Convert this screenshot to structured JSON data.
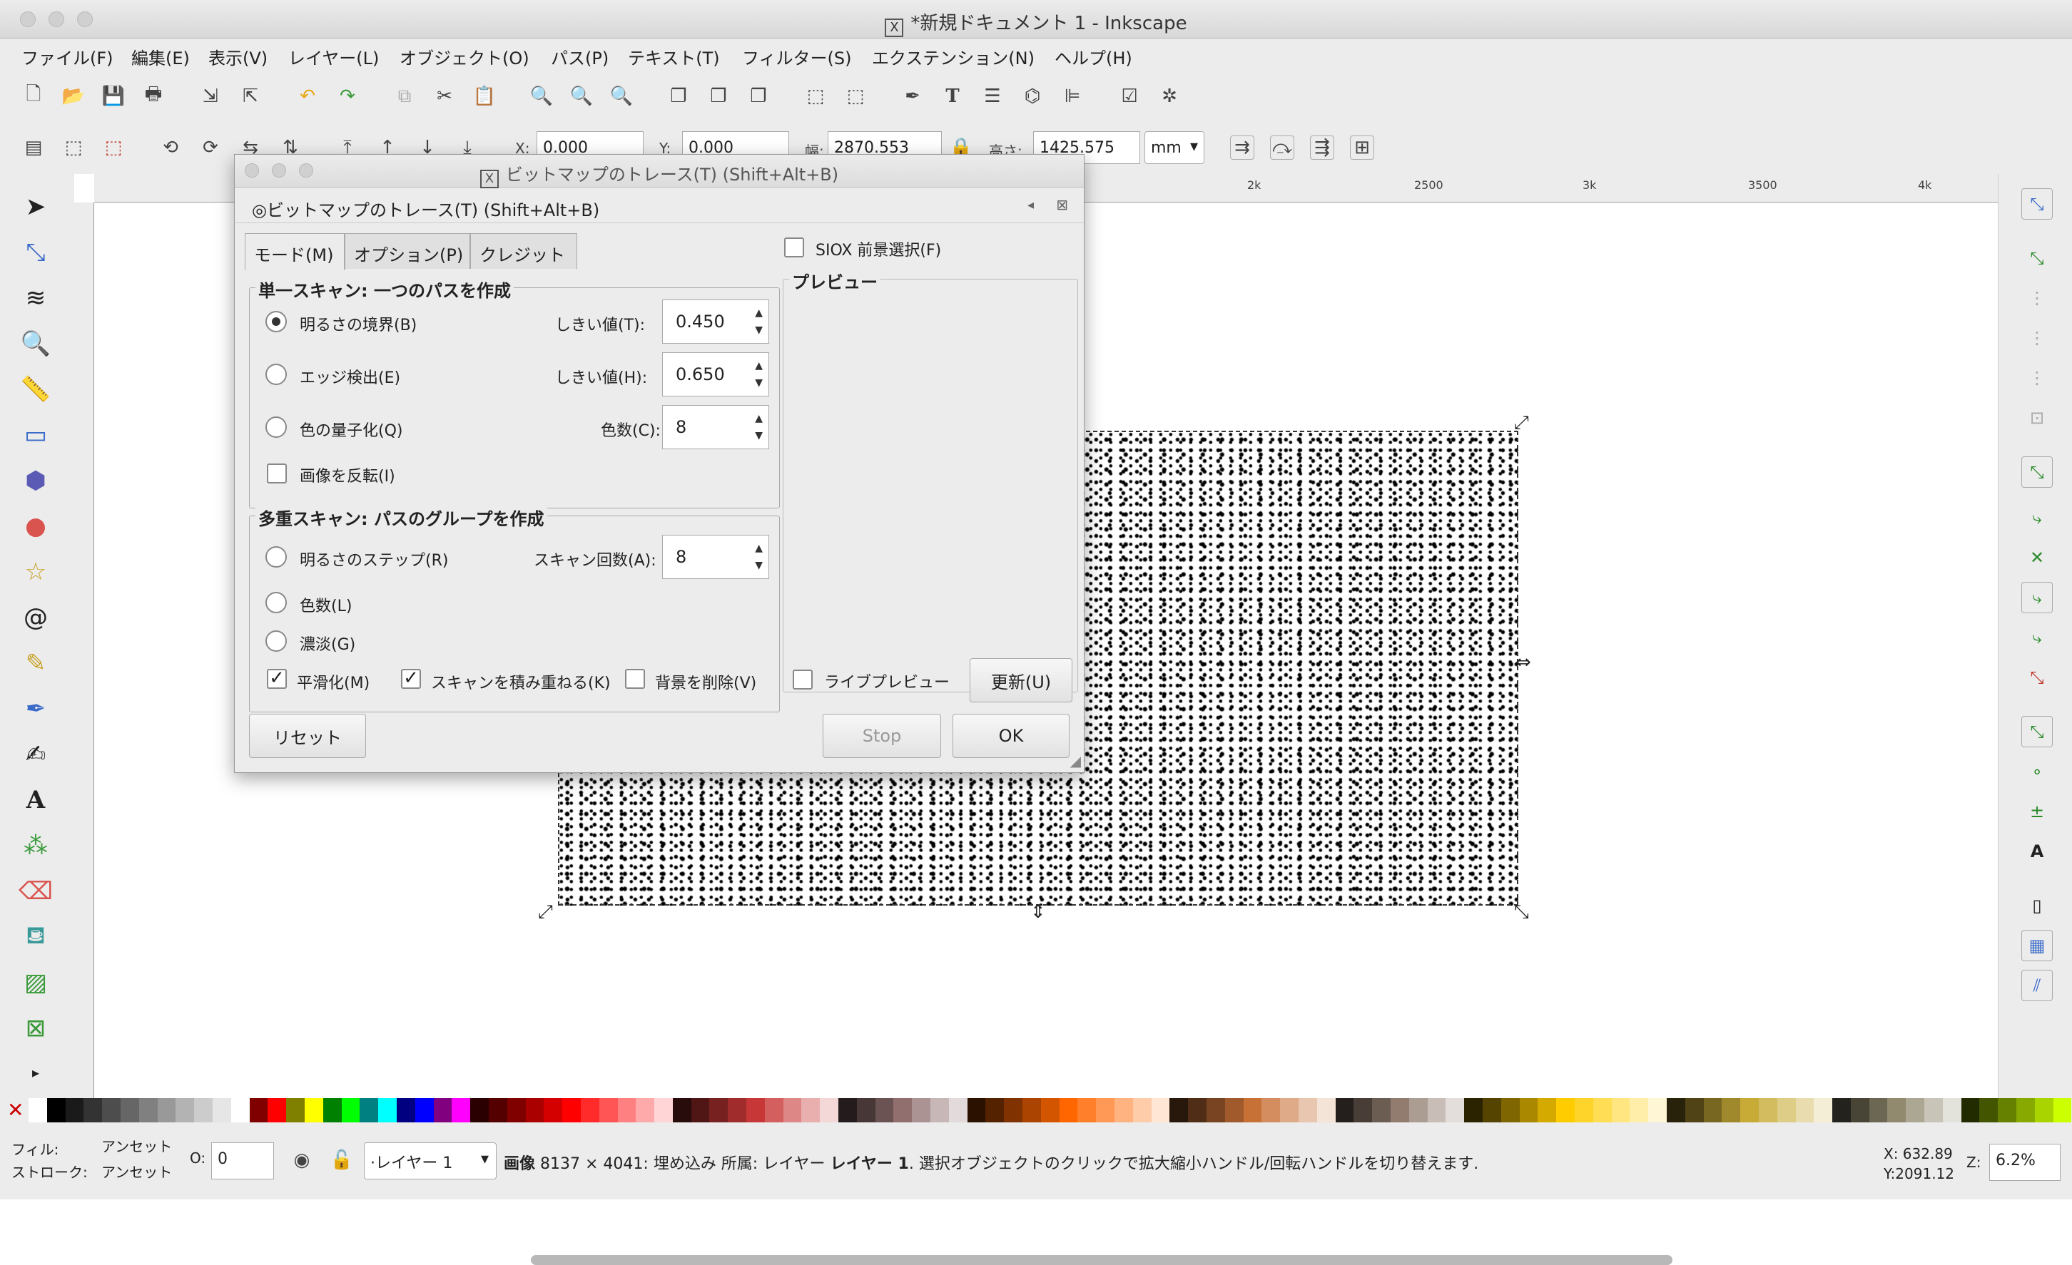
{
  "window": {
    "title": "*新規ドキュメント 1 - Inkscape"
  },
  "menu": [
    "ファイル(F)",
    "編集(E)",
    "表示(V)",
    "レイヤー(L)",
    "オブジェクト(O)",
    "パス(P)",
    "テキスト(T)",
    "フィルター(S)",
    "エクステンション(N)",
    "ヘルプ(H)"
  ],
  "toolctl": {
    "x_label": "X:",
    "x": "0.000",
    "y_label": "Y:",
    "y": "0.000",
    "w_label": "幅:",
    "w": "2870.553",
    "h_label": "高さ:",
    "h": "1425.575",
    "unit": "mm"
  },
  "ruler": [
    "2k",
    "2500",
    "3k",
    "3500",
    "4k"
  ],
  "dialog": {
    "window_title": "ビットマップのトレース(T) (Shift+Alt+B)",
    "header": "ビットマップのトレース(T) (Shift+Alt+B)",
    "tabs": [
      "モード(M)",
      "オプション(P)",
      "クレジット"
    ],
    "single": {
      "title": "単一スキャン: 一つのパスを作成",
      "brightness": "明るさの境界(B)",
      "threshold_t": "しきい値(T):",
      "threshold_t_val": "0.450",
      "edge": "エッジ検出(E)",
      "threshold_h": "しきい値(H):",
      "threshold_h_val": "0.650",
      "quant": "色の量子化(Q)",
      "colors": "色数(C):",
      "colors_val": "8",
      "invert": "画像を反転(I)"
    },
    "multi": {
      "title": "多重スキャン: パスのグループを作成",
      "steps": "明るさのステップ(R)",
      "scans": "スキャン回数(A):",
      "scans_val": "8",
      "colors": "色数(L)",
      "gray": "濃淡(G)",
      "smooth": "平滑化(M)",
      "stack": "スキャンを積み重ねる(K)",
      "remove_bg": "背景を削除(V)"
    },
    "siox": "SIOX 前景選択(F)",
    "preview": "プレビュー",
    "live": "ライブプレビュー",
    "update": "更新(U)",
    "reset": "リセット",
    "stop": "Stop",
    "ok": "OK"
  },
  "status": {
    "fill_label": "フィル:",
    "fill": "アンセット",
    "stroke_label": "ストローク:",
    "stroke": "アンセット",
    "opacity_label": "O:",
    "opacity": "0",
    "layer": "·レイヤー 1",
    "message_bold": "画像",
    "message": "8137 × 4041: 埋め込み 所属: レイヤー",
    "message_layer": "レイヤー 1",
    "message_tail": ". 選択オブジェクトのクリックで拡大縮小ハンドル/回転ハンドルを切り替えます.",
    "x": "X:   632.89",
    "y": "Y:2091.12",
    "z_label": "Z:",
    "zoom": "6.2%"
  },
  "palette": [
    "#000000",
    "#1a1a1a",
    "#333333",
    "#4d4d4d",
    "#666666",
    "#808080",
    "#999999",
    "#b3b3b3",
    "#cccccc",
    "#e6e6e6",
    "#ffffff",
    "#800000",
    "#ff0000",
    "#808000",
    "#ffff00",
    "#008000",
    "#00ff00",
    "#008080",
    "#00ffff",
    "#000080",
    "#0000ff",
    "#800080",
    "#ff00ff",
    "#2b0000",
    "#550000",
    "#800000",
    "#aa0000",
    "#d40000",
    "#ff0000",
    "#ff2a2a",
    "#ff5555",
    "#ff8080",
    "#ffaaaa",
    "#ffd5d5",
    "#280b0b",
    "#501616",
    "#782121",
    "#a02c2c",
    "#c83737",
    "#d35f5f",
    "#de8787",
    "#e9afaf",
    "#f4d7d7",
    "#241c1c",
    "#483737",
    "#6c5353",
    "#916f6f",
    "#ac9393",
    "#c8b7b7",
    "#e3dbdb",
    "#2b1100",
    "#552200",
    "#803300",
    "#aa4400",
    "#d45500",
    "#ff6600",
    "#ff7f2a",
    "#ff9955",
    "#ffb380",
    "#ffccaa",
    "#ffe6d5",
    "#28170b",
    "#502d16",
    "#784421",
    "#a05a2c",
    "#c87137",
    "#d38d5f",
    "#deaa87",
    "#e9c6af",
    "#f4e3d7",
    "#241f1c",
    "#483e37",
    "#6c5d53",
    "#917c6f",
    "#ac9d93",
    "#c8beb7",
    "#e3dedb",
    "#2b2200",
    "#554400",
    "#806600",
    "#aa8800",
    "#d4aa00",
    "#ffcc00",
    "#ffd42a",
    "#ffdd55",
    "#ffe680",
    "#ffeeaa",
    "#fff6d5",
    "#28220b",
    "#504416",
    "#786721",
    "#a0892c",
    "#c8ab37",
    "#d3bc5f",
    "#decd87",
    "#e9ddaf",
    "#f4eed7",
    "#24221c",
    "#484537",
    "#6c6753",
    "#918a6f",
    "#aca793",
    "#c8c4b7",
    "#e3e2db",
    "#222b00",
    "#445500",
    "#668000",
    "#88aa00",
    "#aad400",
    "#ccff00"
  ]
}
